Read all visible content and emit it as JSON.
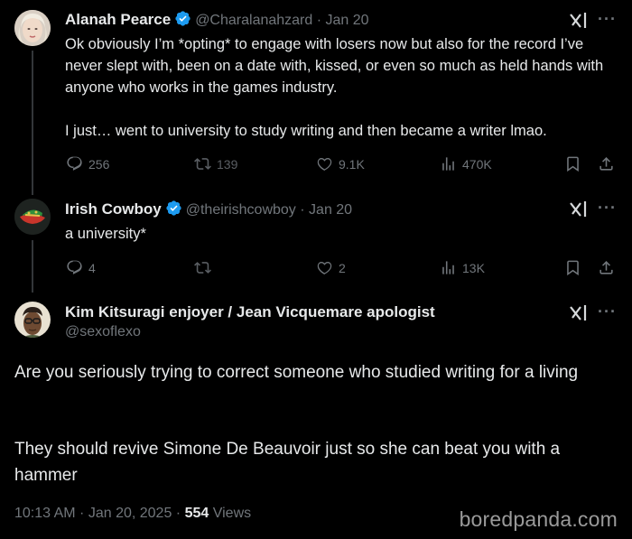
{
  "tweet1": {
    "name": "Alanah Pearce",
    "handle": "@Charalanahzard",
    "date": "· Jan 20",
    "text": "Ok obviously I’m *opting* to engage with losers now but also for the record I’ve never slept with, been on a date with, kissed, or even so much as held hands with anyone who works in the games industry.",
    "text2": "I just… went to university to study writing and then became a writer lmao.",
    "replies": "256",
    "reposts": "139",
    "likes": "9.1K",
    "views": "470K"
  },
  "tweet2": {
    "name": "Irish Cowboy",
    "handle": "@theirishcowboy",
    "date": "· Jan 20",
    "text": "a university*",
    "replies": "4",
    "reposts": "",
    "likes": "2",
    "views": "13K"
  },
  "tweet3": {
    "name": "Kim Kitsuragi enjoyer / Jean Vicquemare apologist",
    "handle": "@sexoflexo",
    "text": "Are you seriously trying to correct someone who studied writing for a living",
    "text2": "They should revive Simone De Beauvoir just so she can beat you with a hammer",
    "time": "10:13 AM · Jan 20, 2025 ·",
    "views_count": "554",
    "views_label": "Views"
  },
  "watermark": "boredpanda.com",
  "colors": {
    "background": "#000000",
    "text": "#e7e9ea",
    "muted": "#71767b",
    "verified": "#1d9bf0",
    "thread_line": "#333639"
  },
  "icons": [
    "verified-badge-icon",
    "grok-icon",
    "more-icon",
    "reply-icon",
    "repost-icon",
    "like-icon",
    "views-icon",
    "bookmark-icon",
    "share-icon"
  ]
}
